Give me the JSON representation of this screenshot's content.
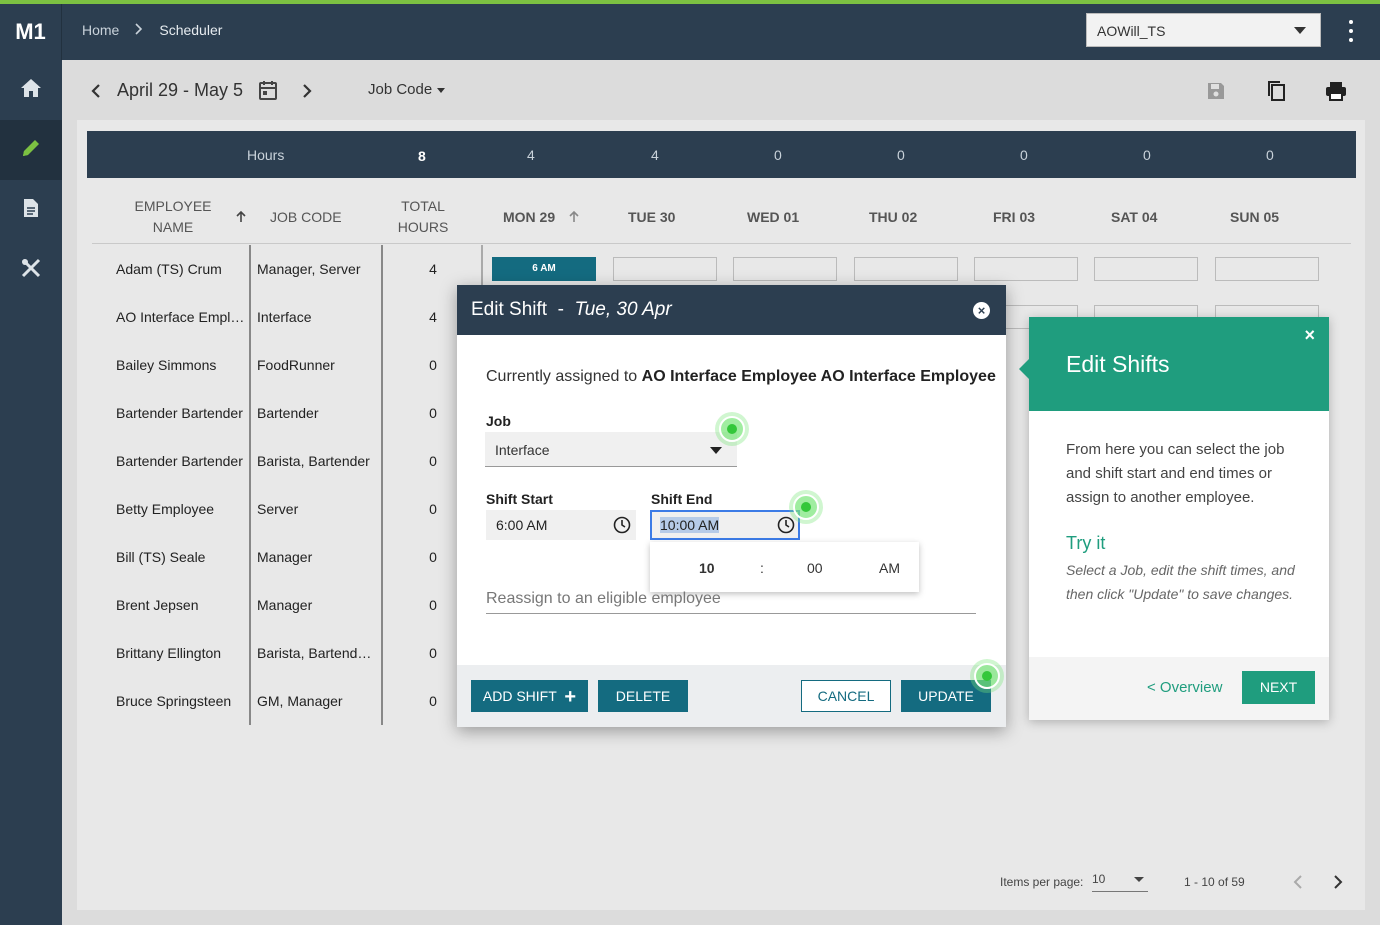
{
  "app": {
    "logo": "M1"
  },
  "breadcrumb": {
    "home": "Home",
    "current": "Scheduler"
  },
  "store": {
    "selected": "AOWill_TS"
  },
  "nav": {
    "items": [
      "home-icon",
      "edit-icon",
      "document-icon",
      "tools-icon"
    ],
    "active": 1
  },
  "toolbar": {
    "date_range": "April 29 - May 5",
    "group_by": "Job Code"
  },
  "hours_bar": {
    "label": "Hours",
    "total": "8",
    "days": [
      "4",
      "4",
      "0",
      "0",
      "0",
      "0",
      "0"
    ]
  },
  "columns": {
    "employee_1": "EMPLOYEE",
    "employee_2": "NAME",
    "job_code": "JOB CODE",
    "total_1": "TOTAL",
    "total_2": "HOURS",
    "days": [
      "MON 29",
      "TUE 30",
      "WED 01",
      "THU 02",
      "FRI 03",
      "SAT 04",
      "SUN 05"
    ]
  },
  "rows": [
    {
      "name": "Adam (TS) Crum",
      "job": "Manager, Server",
      "hours": "4"
    },
    {
      "name": "AO Interface Employee AO Interface Employee",
      "job": "Interface",
      "hours": "4"
    },
    {
      "name": "Bailey Simmons",
      "job": "FoodRunner",
      "hours": "0"
    },
    {
      "name": "Bartender Bartender",
      "job": "Bartender",
      "hours": "0"
    },
    {
      "name": "Bartender Bartender",
      "job": "Barista, Bartender",
      "hours": "0"
    },
    {
      "name": "Betty Employee",
      "job": "Server",
      "hours": "0"
    },
    {
      "name": "Bill (TS) Seale",
      "job": "Manager",
      "hours": "0"
    },
    {
      "name": "Brent Jepsen",
      "job": "Manager",
      "hours": "0"
    },
    {
      "name": "Brittany Ellington",
      "job": "Barista, Bartender, Server",
      "hours": "0"
    },
    {
      "name": "Bruce Springsteen",
      "job": "GM, Manager",
      "hours": "0"
    }
  ],
  "shift_block": "6 AM",
  "pager": {
    "label": "Items per page:",
    "per_page": "10",
    "range": "1 - 10 of 59"
  },
  "modal": {
    "title": "Edit Shift",
    "date": "Tue, 30 Apr",
    "assigned_prefix": "Currently assigned to",
    "assigned_name": "AO Interface Employee AO Interface Employee",
    "job_label": "Job",
    "job_value": "Interface",
    "start_label": "Shift Start",
    "start_value": "6:00 AM",
    "end_label": "Shift End",
    "end_value": "10:00 AM",
    "picker": {
      "hour": "10",
      "sep": ":",
      "minute": "00",
      "ampm": "AM"
    },
    "reassign_placeholder": "Reassign to an eligible employee",
    "buttons": {
      "add": "ADD SHIFT",
      "delete": "DELETE",
      "cancel": "CANCEL",
      "update": "UPDATE"
    }
  },
  "tour": {
    "title": "Edit Shifts",
    "close": "×",
    "body": "From here you can select the job and shift start and end times or assign to another employee.",
    "try_title": "Try it",
    "try_text": "Select a Job, edit the shift times, and then click \"Update\" to save changes.",
    "back": "< Overview",
    "next": "NEXT"
  },
  "colors": {
    "nav": "#2c3e50",
    "accent": "#146b80",
    "tour": "#1f9d7e",
    "beacon": "#34c73a"
  }
}
